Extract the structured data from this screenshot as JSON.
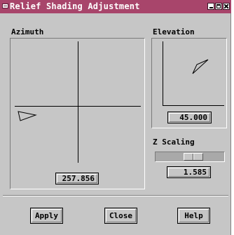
{
  "window": {
    "title": "Relief Shading Adjustment"
  },
  "azimuth": {
    "label": "Azimuth",
    "value": "257.856"
  },
  "elevation": {
    "label": "Elevation",
    "value": "45.000"
  },
  "z_scaling": {
    "label": "Z Scaling",
    "value": "1.585"
  },
  "buttons": {
    "apply": "Apply",
    "close": "Close",
    "help": "Help"
  },
  "colors": {
    "titlebar": "#a8456b",
    "dialog_bg": "#c6c6c6"
  }
}
